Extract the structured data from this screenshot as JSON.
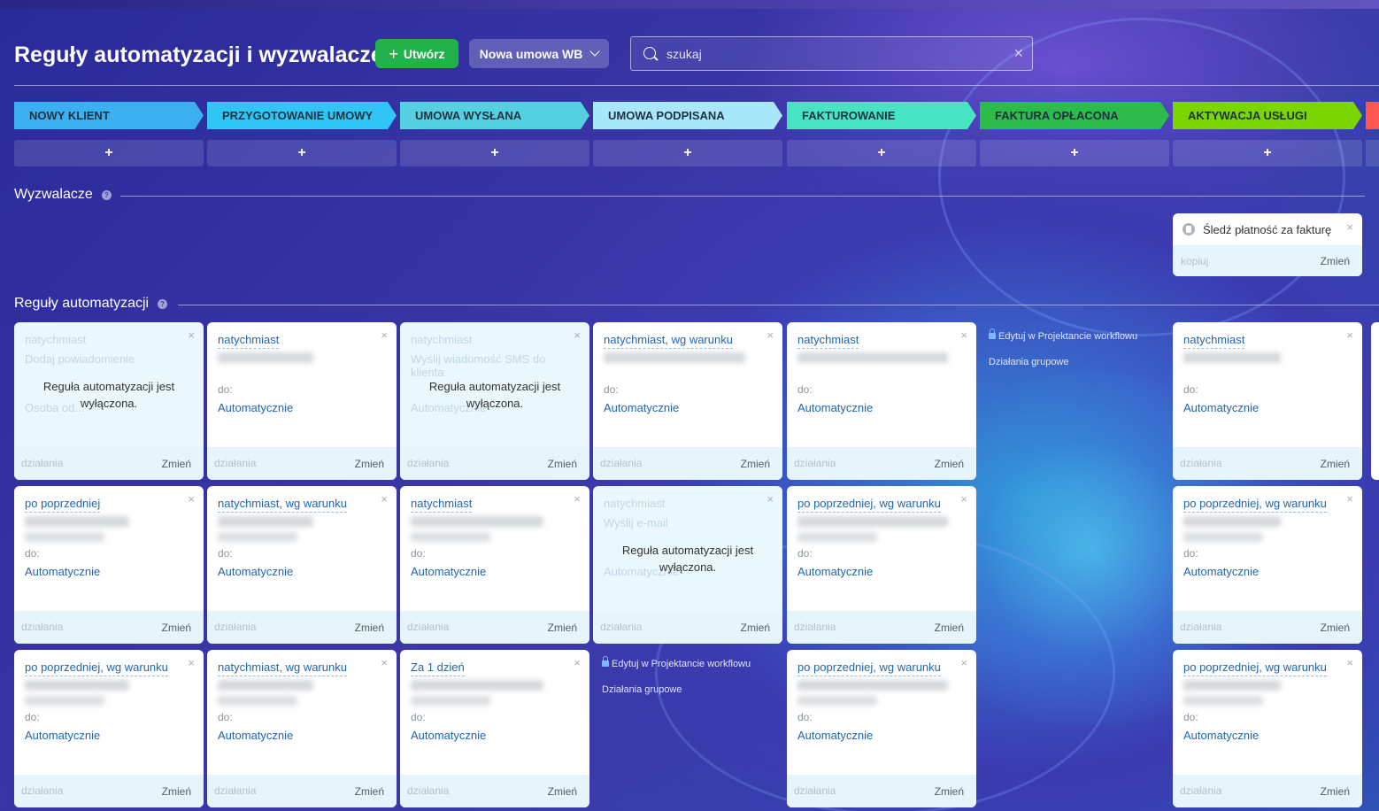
{
  "header": {
    "title": "Reguły automatyzacji i wyzwalacze",
    "create_label": "Utwórz",
    "template_label": "Nowa umowa WB",
    "search_placeholder": "szukaj"
  },
  "stages": [
    {
      "label": "NOWY KLIENT",
      "color": "#3bb0f0"
    },
    {
      "label": "PRZYGOTOWANIE UMOWY",
      "color": "#2fc6f6"
    },
    {
      "label": "UMOWA WYSŁANA",
      "color": "#55d0e0"
    },
    {
      "label": "UMOWA PODPISANA",
      "color": "#a9e8fb"
    },
    {
      "label": "FAKTUROWANIE",
      "color": "#47e4c2"
    },
    {
      "label": "FAKTURA OPŁACONA",
      "color": "#2dbb4b"
    },
    {
      "label": "AKTYWACJA USŁUGI",
      "color": "#7bd500"
    }
  ],
  "add_label": "+",
  "sections": {
    "triggers": "Wyzwalacze",
    "rules": "Reguły automatyzacji",
    "help": "?"
  },
  "trigger": {
    "title": "Śledź płatność za fakturę",
    "copy": "kopiuj",
    "change": "Zmień"
  },
  "card_text": {
    "do": "do:",
    "auto": "Automatycznie",
    "actions": "działania",
    "change": "Zmień",
    "close": "×",
    "disabled_msg": "Reguła automatyzacji jest wyłączona."
  },
  "workflow": {
    "edit": "Edytuj w Projektancie workflowu",
    "group": "Działania grupowe"
  },
  "rows": [
    [
      {
        "col": 0,
        "disabled": true,
        "title": "natychmiast",
        "line1": "Dodaj powiadomienie",
        "line2": "Osoba od..."
      },
      {
        "col": 1,
        "title": "natychmiast"
      },
      {
        "col": 2,
        "disabled": true,
        "title": "natychmiast",
        "line1": "Wyślij wiadomość SMS do klienta",
        "line2": "Automatycznie"
      },
      {
        "col": 3,
        "title": "natychmiast, wg warunku"
      },
      {
        "col": 4,
        "title": "natychmiast"
      },
      {
        "col": 5,
        "workflow": true
      },
      {
        "col": 6,
        "title": "natychmiast"
      }
    ],
    [
      {
        "col": 0,
        "title": "po poprzedniej"
      },
      {
        "col": 1,
        "title": "natychmiast, wg warunku"
      },
      {
        "col": 2,
        "title": "natychmiast"
      },
      {
        "col": 3,
        "disabled": true,
        "title": "natychmiast",
        "line1": "Wyślij e-mail",
        "line2": "Automatycznie"
      },
      {
        "col": 4,
        "title": "po poprzedniej, wg warunku"
      },
      {
        "col": 6,
        "title": "po poprzedniej, wg warunku"
      }
    ],
    [
      {
        "col": 0,
        "title": "po poprzedniej, wg warunku"
      },
      {
        "col": 1,
        "title": "natychmiast, wg warunku"
      },
      {
        "col": 2,
        "title": "Za 1 dzień"
      },
      {
        "col": 3,
        "workflow": true
      },
      {
        "col": 4,
        "title": "po poprzedniej, wg warunku"
      },
      {
        "col": 6,
        "title": "po poprzedniej, wg warunku"
      }
    ]
  ]
}
